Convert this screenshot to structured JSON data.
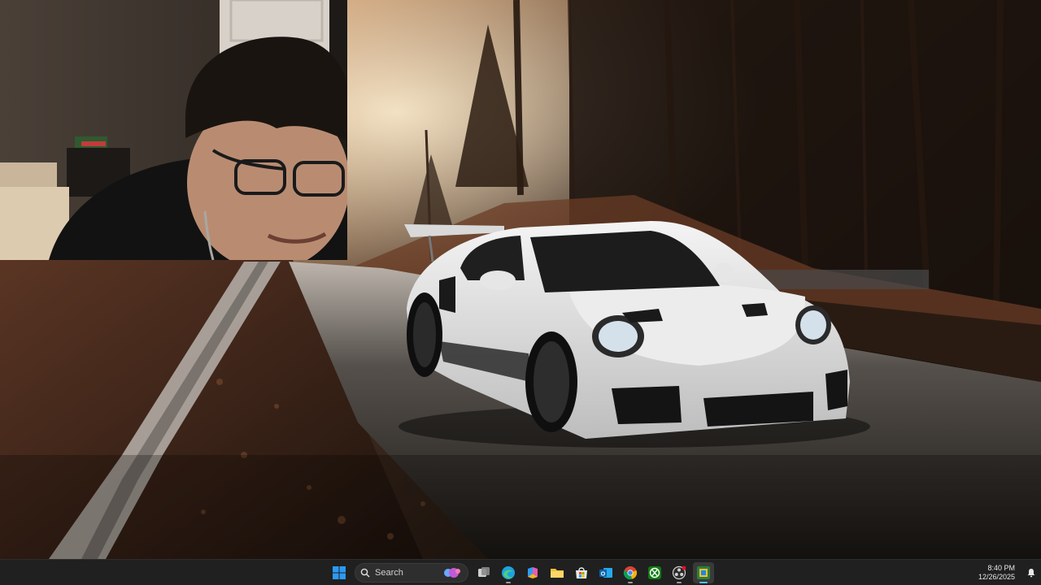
{
  "taskbar": {
    "search": {
      "label": "Search"
    },
    "apps": [
      {
        "name": "start-button",
        "icon": "windows-logo-icon"
      },
      {
        "name": "task-view-button",
        "icon": "task-view-icon"
      },
      {
        "name": "edge-button",
        "icon": "edge-icon"
      },
      {
        "name": "copilot-button",
        "icon": "copilot-icon"
      },
      {
        "name": "file-explorer-button",
        "icon": "folder-icon"
      },
      {
        "name": "microsoft-store-button",
        "icon": "store-icon"
      },
      {
        "name": "outlook-button",
        "icon": "outlook-icon"
      },
      {
        "name": "chrome-button",
        "icon": "chrome-icon"
      },
      {
        "name": "xbox-button",
        "icon": "xbox-icon"
      },
      {
        "name": "obs-button",
        "icon": "obs-icon"
      },
      {
        "name": "game-app-button",
        "icon": "app-tile-icon"
      }
    ],
    "clock": {
      "time": "8:40 PM",
      "date": "12/26/2025"
    }
  },
  "colors": {
    "taskbar_bg": "#202020",
    "accent": "#4cc2ff",
    "windows_blue": "#2b9af3"
  }
}
